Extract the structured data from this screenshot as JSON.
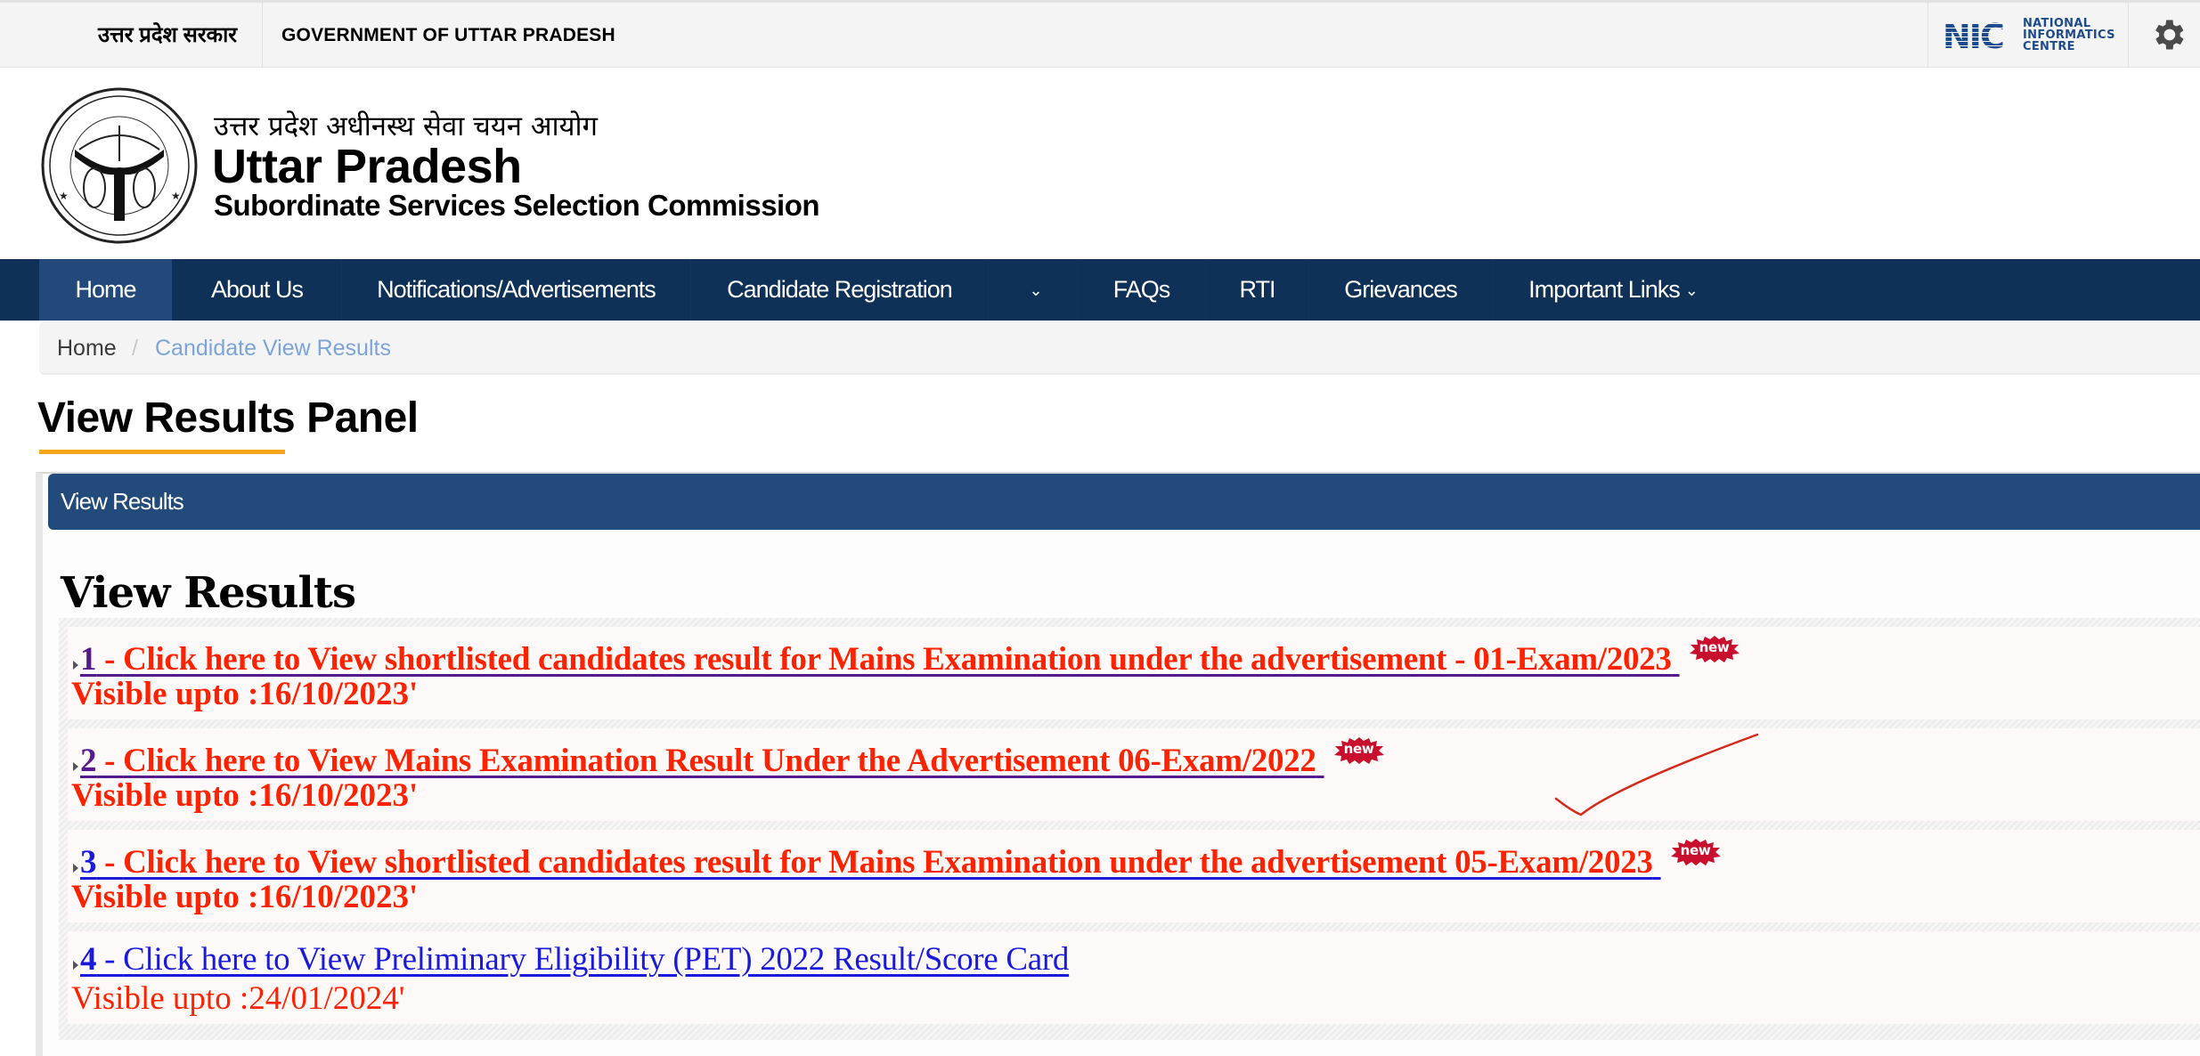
{
  "gov_bar": {
    "hindi_label": "उत्तर प्रदेश सरकार",
    "english_label": "GOVERNMENT OF UTTAR PRADESH",
    "nic_logo_mark": "NIC",
    "nic_logo_text": [
      "NATIONAL",
      "INFORMATICS",
      "CENTRE"
    ],
    "settings_icon": "gear-icon"
  },
  "brand": {
    "emblem_icon": "up-government-emblem",
    "hindi_name": "उत्तर प्रदेश अधीनस्थ सेवा चयन आयोग",
    "title": "Uttar Pradesh",
    "subtitle": "Subordinate Services Selection Commission"
  },
  "nav": {
    "items": [
      {
        "label": "Home",
        "active": true
      },
      {
        "label": "About Us"
      },
      {
        "label": "Notifications/Advertisements"
      },
      {
        "label": "Candidate Registration"
      },
      {
        "label": "",
        "icon": "chevron-down-icon"
      },
      {
        "label": "FAQs"
      },
      {
        "label": "RTI"
      },
      {
        "label": "Grievances"
      },
      {
        "label": "Important Links",
        "icon": "chevron-down-icon"
      }
    ]
  },
  "breadcrumb": {
    "home": "Home",
    "separator": "/",
    "current": "Candidate View Results"
  },
  "page": {
    "title": "View Results Panel",
    "accent_color": "#f5a51a"
  },
  "panel": {
    "header": "View Results",
    "heading": "View Results",
    "results": [
      {
        "number": "1",
        "dash": " - ",
        "text": "Click here to View shortlisted candidates result for Mains Examination under the advertisement - 01-Exam/2023",
        "is_new": true,
        "new_label": "new",
        "visible_upto": "Visible upto :16/10/2023'"
      },
      {
        "number": "2",
        "dash": " - ",
        "text": "Click here to View Mains Examination Result Under the Advertisement 06-Exam/2022",
        "is_new": true,
        "new_label": "new",
        "visible_upto": "Visible upto :16/10/2023'"
      },
      {
        "number": "3",
        "dash": " - ",
        "text": "Click here to View shortlisted candidates result for Mains Examination under the advertisement 05-Exam/2023",
        "is_new": true,
        "new_label": "new",
        "visible_upto": "Visible upto :16/10/2023'"
      },
      {
        "number": "4",
        "dash": " - ",
        "text": "Click here to View Preliminary Eligibility (PET) 2022 Result/Score Card",
        "is_new": false,
        "visible_upto": "Visible upto :24/01/2024'"
      }
    ]
  },
  "colors": {
    "nav_bg": "#103157",
    "nav_active": "#22497a",
    "panel_header": "#224b7c",
    "result_red": "#ff2200",
    "link_blue": "#1a1adb",
    "visited_purple": "#551a8b"
  }
}
